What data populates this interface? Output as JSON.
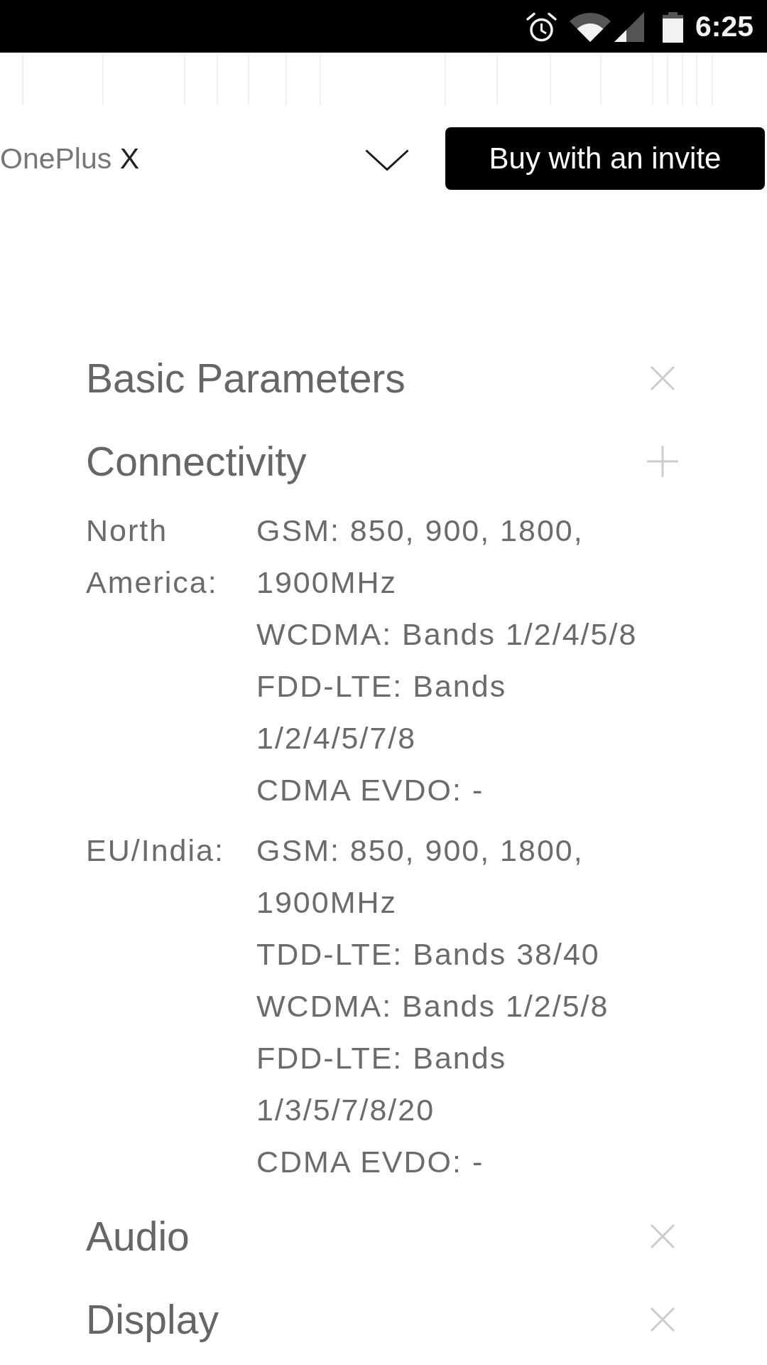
{
  "status_bar": {
    "time": "6:25"
  },
  "header": {
    "brand": "OnePlus",
    "model": "X",
    "button": "Buy with an invite"
  },
  "sections": [
    {
      "title": "Basic Parameters",
      "expanded": false
    },
    {
      "title": "Connectivity",
      "expanded": true,
      "regions": [
        {
          "label": "North America:",
          "lines": [
            "GSM: 850, 900, 1800, 1900MHz",
            "WCDMA: Bands 1/2/4/5/8",
            "FDD-LTE: Bands 1/2/4/5/7/8",
            "CDMA EVDO: -"
          ]
        },
        {
          "label": "EU/India:",
          "lines": [
            "GSM: 850, 900, 1800, 1900MHz",
            "TDD-LTE: Bands 38/40",
            "WCDMA: Bands 1/2/5/8",
            "FDD-LTE: Bands 1/3/5/7/8/20",
            "CDMA EVDO: -"
          ]
        }
      ]
    },
    {
      "title": "Audio",
      "expanded": false
    },
    {
      "title": "Display",
      "expanded": false
    }
  ]
}
